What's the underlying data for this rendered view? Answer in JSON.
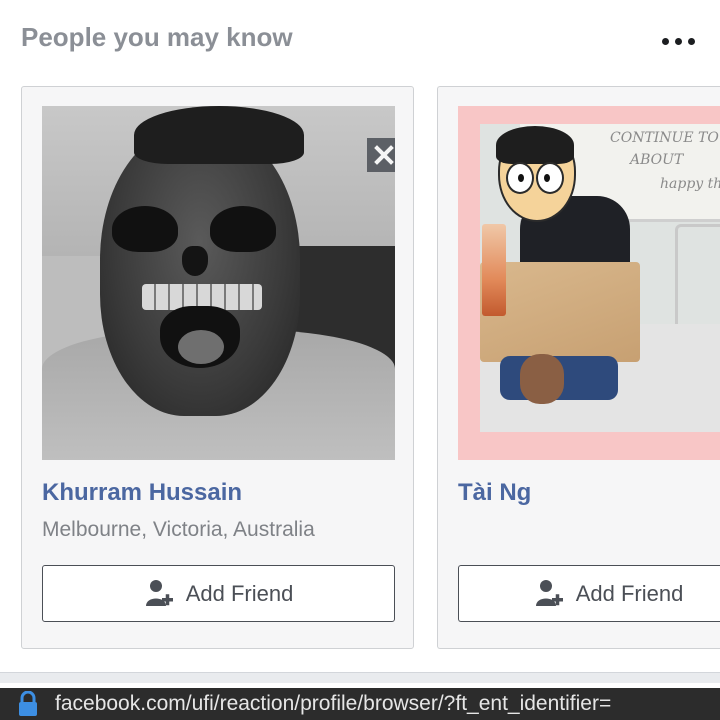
{
  "section": {
    "title": "People you may know",
    "more_icon": "more-horizontal-icon"
  },
  "cards": [
    {
      "name": "Khurram Hussain",
      "location": "Melbourne, Victoria, Australia",
      "button_label": "Add Friend",
      "button_icon": "add-friend-icon",
      "dismiss_icon": "close-icon"
    },
    {
      "name": "Tài Ng",
      "location": "",
      "button_label": "Add Friend",
      "button_icon": "add-friend-icon"
    }
  ],
  "url_bar": {
    "lock_icon": "lock-icon",
    "url": "facebook.com/ufi/reaction/profile/browser/?ft_ent_identifier="
  },
  "colors": {
    "name_link": "#4b67a1",
    "title_gray": "#8b8f96",
    "location_gray": "#7f8287",
    "button_border": "#4b4f56",
    "url_bar_bg": "#2c2c2c",
    "lock_blue": "#3d8fe3"
  }
}
